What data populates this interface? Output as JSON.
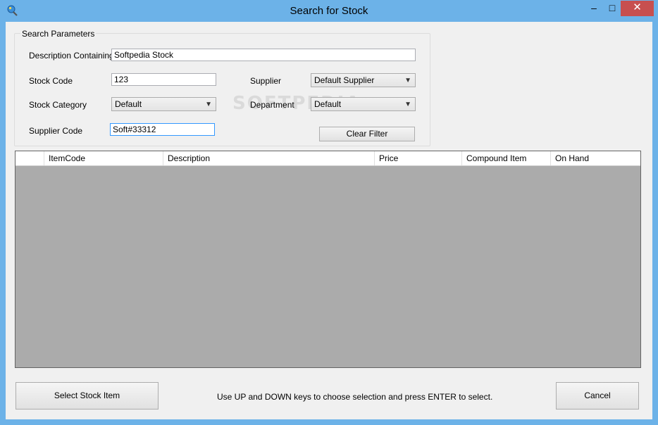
{
  "window": {
    "title": "Search for Stock"
  },
  "titlebar_buttons": {
    "minimize": "–",
    "maximize": "□",
    "close": "✕"
  },
  "search_parameters": {
    "legend": "Search Parameters",
    "description_label": "Description Containing",
    "description_value": "Softpedia Stock",
    "stock_code_label": "Stock Code",
    "stock_code_value": "123",
    "supplier_label": "Supplier",
    "supplier_value": "Default Supplier",
    "stock_category_label": "Stock Category",
    "stock_category_value": "Default",
    "department_label": "Department",
    "department_value": "Default",
    "supplier_code_label": "Supplier Code",
    "supplier_code_value": "Soft#33312",
    "clear_filter_label": "Clear Filter"
  },
  "watermark": "SOFTPEDIA",
  "grid": {
    "columns": [
      "",
      "ItemCode",
      "Description",
      "Price",
      "Compound Item",
      "On Hand"
    ]
  },
  "footer": {
    "select_button": "Select Stock Item",
    "hint": "Use UP and DOWN keys to choose selection and press ENTER to select.",
    "cancel_button": "Cancel"
  },
  "icons": {
    "app": "magnifier-globe-icon",
    "dropdown": "chevron-down-icon"
  },
  "colors": {
    "titlebar": "#6cb2e8",
    "close": "#c74f4f",
    "grid_bg": "#ababab"
  }
}
